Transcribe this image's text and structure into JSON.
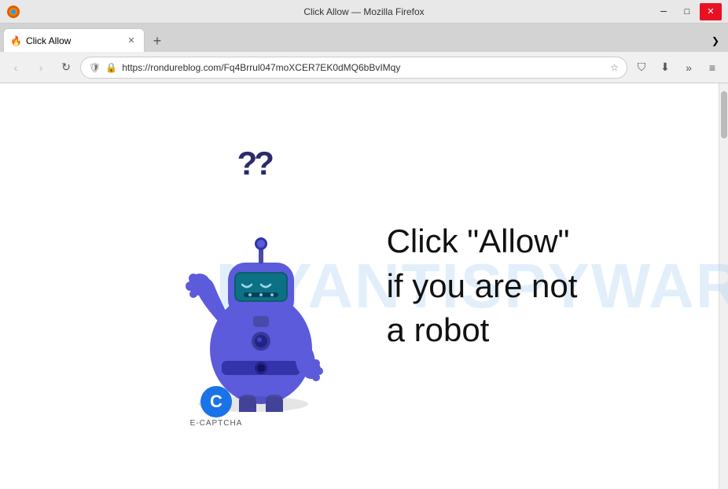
{
  "titlebar": {
    "title": "Click Allow — Mozilla Firefox",
    "minimize_label": "─",
    "maximize_label": "□",
    "close_label": "✕"
  },
  "tab": {
    "label": "Click Allow",
    "favicon": "🔥",
    "close_label": "✕"
  },
  "tabbar": {
    "new_tab_label": "+",
    "tab_list_label": "❯"
  },
  "navbar": {
    "back_label": "‹",
    "forward_label": "›",
    "reload_label": "↻",
    "url": "https://rondureblog.com/Fq4Brrul047moXCER7EK0dMQ6bBvIMqy",
    "shield_label": "🛡",
    "lock_label": "🔒",
    "star_label": "☆",
    "shield2_label": "⛉",
    "download_label": "⬇",
    "more_label": "»",
    "menu_label": "≡"
  },
  "watermark": {
    "line1": "MYANTISPYWARE.COM"
  },
  "main_message": {
    "line1": "Click \"Allow\"",
    "line2": "if you are not",
    "line3": "a robot"
  },
  "captcha": {
    "letter": "C",
    "label": "E-CAPTCHA"
  },
  "question_marks": "??",
  "scrollbar": {
    "visible": true
  }
}
